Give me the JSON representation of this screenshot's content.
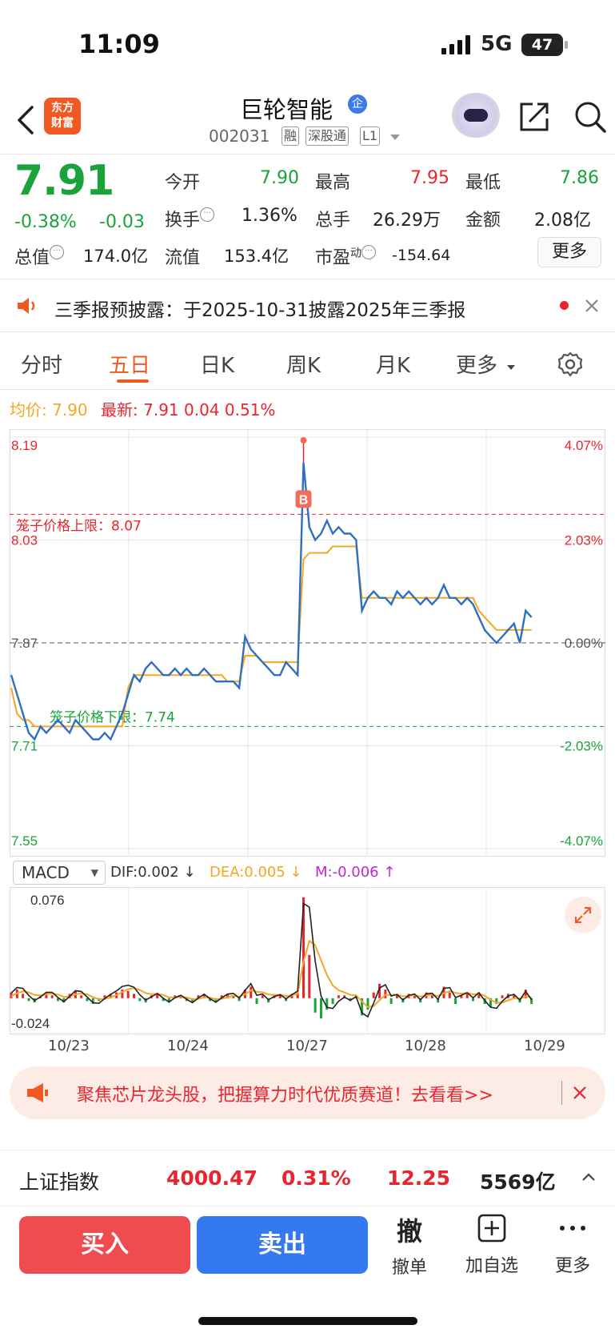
{
  "status": {
    "time": "11:09",
    "network": "5G",
    "battery": "47"
  },
  "header": {
    "logo_text": "东方财富",
    "title": "巨轮智能",
    "badge": "企",
    "code": "002031",
    "tags": [
      "融",
      "深股通",
      "L1"
    ]
  },
  "quote": {
    "price": "7.91",
    "change_pct": "-0.38%",
    "change": "-0.03",
    "open_label": "今开",
    "open": "7.90",
    "high_label": "最高",
    "high": "7.95",
    "low_label": "最低",
    "low": "7.86",
    "turnover_label": "换手",
    "turnover": "1.36%",
    "volume_label": "总手",
    "volume": "26.29万",
    "amount_label": "金额",
    "amount": "2.08亿",
    "mktcap_label": "总值",
    "mktcap": "174.0亿",
    "float_label": "流值",
    "float": "153.4亿",
    "pe_label": "市盈",
    "pe_sup": "动",
    "pe": "-154.64",
    "more": "更多"
  },
  "notice": {
    "text": "三季报预披露：于2025-10-31披露2025年三季报"
  },
  "tabs": [
    "分时",
    "五日",
    "日K",
    "周K",
    "月K",
    "更多"
  ],
  "avg_line": {
    "avg_label": "均价:",
    "avg": "7.90",
    "latest_label": "最新:",
    "latest": "7.91",
    "chg": "0.04",
    "pct": "0.51%"
  },
  "chart_data": {
    "type": "line",
    "y_left_ticks": [
      "8.19",
      "8.03",
      "7.87",
      "7.71",
      "7.55"
    ],
    "y_right_ticks": [
      "4.07%",
      "2.03%",
      "0.00%",
      "-2.03%",
      "-4.07%"
    ],
    "upper_limit_label": "笼子价格上限：8.07",
    "lower_limit_label": "笼子价格下限：7.74",
    "upper_limit": 8.07,
    "lower_limit": 7.74,
    "prev_close": 7.87,
    "ylim": [
      7.55,
      8.19
    ],
    "marker": "B",
    "x_labels": [
      "10/23",
      "10/24",
      "10/27",
      "10/28",
      "10/29"
    ],
    "series": [
      {
        "values": [
          7.82,
          7.79,
          7.76,
          7.73,
          7.72,
          7.74,
          7.73,
          7.74,
          7.75,
          7.74,
          7.73,
          7.75,
          7.74,
          7.73,
          7.72,
          7.72,
          7.73,
          7.72,
          7.74,
          7.76,
          7.79,
          7.82,
          7.81,
          7.83,
          7.84,
          7.83,
          7.82,
          7.82,
          7.83,
          7.82,
          7.83,
          7.82,
          7.82,
          7.83,
          7.82,
          7.81,
          7.81,
          7.81,
          7.81,
          7.8,
          7.88,
          7.86,
          7.85,
          7.84,
          7.83,
          7.82,
          7.82,
          7.84,
          7.83,
          7.82,
          8.15,
          8.05,
          8.03,
          8.04,
          8.06,
          8.04,
          8.05,
          8.04,
          8.04,
          8.03,
          7.92,
          7.94,
          7.95,
          7.94,
          7.94,
          7.93,
          7.95,
          7.94,
          7.95,
          7.94,
          7.93,
          7.94,
          7.93,
          7.94,
          7.96,
          7.94,
          7.94,
          7.93,
          7.94,
          7.93,
          7.91,
          7.89,
          7.88,
          7.87,
          7.88,
          7.89,
          7.9,
          7.87,
          7.92,
          7.91
        ]
      },
      {
        "values": [
          7.8,
          7.76,
          7.75,
          7.75,
          7.74,
          7.74,
          7.74,
          7.74,
          7.74,
          7.74,
          7.74,
          7.74,
          7.74,
          7.74,
          7.74,
          7.74,
          7.74,
          7.74,
          7.74,
          7.74,
          7.8,
          7.82,
          7.82,
          7.82,
          7.82,
          7.82,
          7.82,
          7.82,
          7.82,
          7.82,
          7.82,
          7.82,
          7.82,
          7.82,
          7.82,
          7.82,
          7.82,
          7.81,
          7.81,
          7.81,
          7.85,
          7.85,
          7.85,
          7.84,
          7.84,
          7.84,
          7.84,
          7.84,
          7.84,
          7.84,
          8.0,
          8.01,
          8.01,
          8.01,
          8.01,
          8.02,
          8.02,
          8.02,
          8.02,
          8.02,
          7.94,
          7.94,
          7.94,
          7.94,
          7.94,
          7.94,
          7.94,
          7.94,
          7.94,
          7.94,
          7.94,
          7.94,
          7.94,
          7.94,
          7.94,
          7.94,
          7.94,
          7.94,
          7.94,
          7.94,
          7.92,
          7.91,
          7.9,
          7.89,
          7.89,
          7.89,
          7.89,
          7.89,
          7.89,
          7.89
        ]
      }
    ]
  },
  "macd": {
    "selector": "MACD",
    "dif": "DIF:0.002 ↓",
    "dea": "DEA:0.005 ↓",
    "m": "M:-0.006 ↑",
    "top_label": "0.076",
    "bottom_label": "-0.024",
    "chart_data": {
      "type": "bar",
      "ylim": [
        -0.024,
        0.076
      ],
      "values": [
        0.004,
        0.006,
        0.003,
        -0.002,
        -0.003,
        0.002,
        0.004,
        0.002,
        -0.002,
        -0.003,
        0.003,
        0.005,
        0.002,
        -0.002,
        -0.004,
        -0.002,
        0.002,
        0.003,
        0.004,
        0.006,
        0.005,
        0.003,
        -0.002,
        -0.003,
        0.002,
        0.003,
        -0.002,
        -0.003,
        0.002,
        0.002,
        -0.002,
        -0.003,
        0.002,
        0.003,
        -0.002,
        -0.003,
        0.002,
        0.003,
        0.002,
        -0.002,
        0.006,
        0.008,
        -0.004,
        0.002,
        -0.003,
        0.002,
        0.002,
        -0.002,
        0.003,
        0.004,
        0.07,
        0.03,
        -0.01,
        -0.014,
        -0.008,
        -0.004,
        0.002,
        0.002,
        -0.002,
        0.002,
        -0.012,
        -0.008,
        0.004,
        0.01,
        0.006,
        -0.004,
        0.002,
        -0.003,
        0.003,
        0.002,
        -0.003,
        0.004,
        0.002,
        -0.003,
        0.008,
        0.004,
        -0.004,
        0.002,
        0.003,
        -0.002,
        0.004,
        -0.004,
        -0.006,
        -0.004,
        0.002,
        0.003,
        0.002,
        -0.003,
        0.006,
        -0.004
      ]
    }
  },
  "promo": {
    "text": "聚焦芯片龙头股，把握算力时代优质赛道！去看看>>"
  },
  "index_bar": {
    "name": "上证指数",
    "value": "4000.47",
    "pct": "0.31%",
    "change": "12.25",
    "amount": "5569亿"
  },
  "actions": {
    "buy": "买入",
    "sell": "卖出",
    "cancel_icon": "撤",
    "cancel": "撤单",
    "add": "加自选",
    "more": "更多"
  },
  "colors": {
    "up": "#e8252e",
    "down": "#19a33a",
    "accent": "#f05a22",
    "price_line": "#2e6fc0",
    "avg_line": "#f5a623"
  }
}
